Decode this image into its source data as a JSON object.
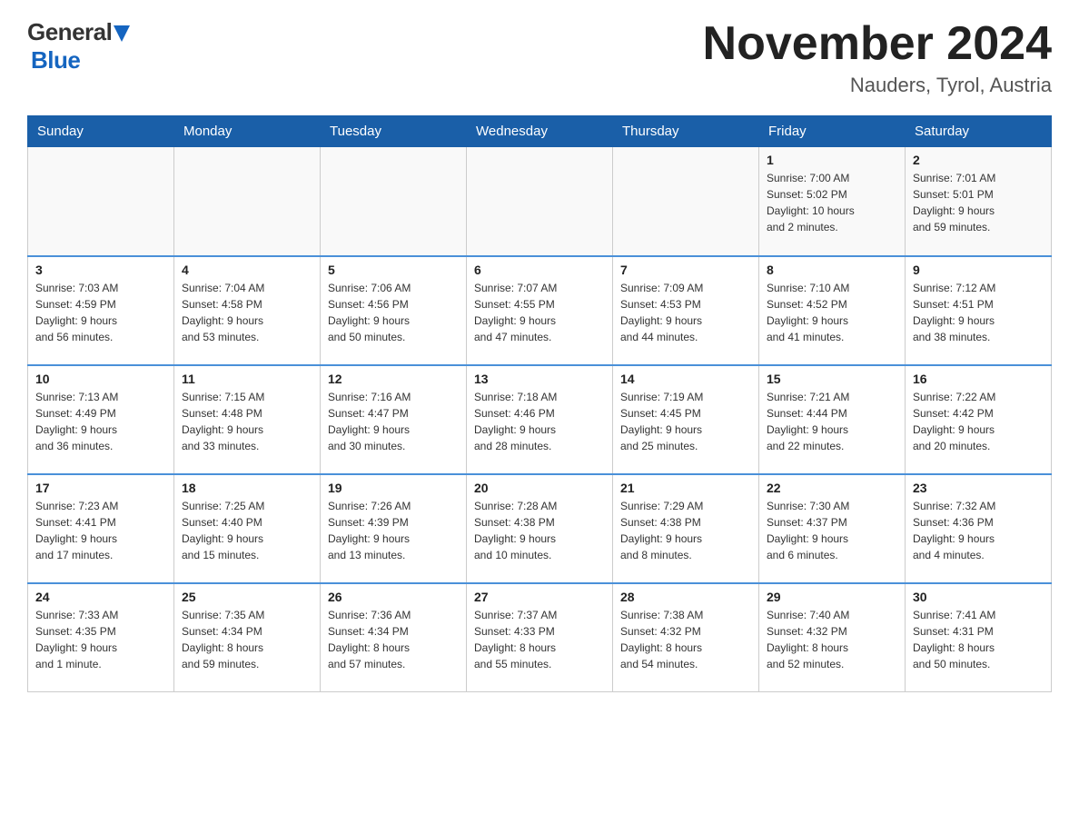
{
  "header": {
    "logo_general": "General",
    "logo_blue": "Blue",
    "month_title": "November 2024",
    "location": "Nauders, Tyrol, Austria"
  },
  "weekdays": [
    "Sunday",
    "Monday",
    "Tuesday",
    "Wednesday",
    "Thursday",
    "Friday",
    "Saturday"
  ],
  "weeks": [
    [
      {
        "day": "",
        "info": ""
      },
      {
        "day": "",
        "info": ""
      },
      {
        "day": "",
        "info": ""
      },
      {
        "day": "",
        "info": ""
      },
      {
        "day": "",
        "info": ""
      },
      {
        "day": "1",
        "info": "Sunrise: 7:00 AM\nSunset: 5:02 PM\nDaylight: 10 hours\nand 2 minutes."
      },
      {
        "day": "2",
        "info": "Sunrise: 7:01 AM\nSunset: 5:01 PM\nDaylight: 9 hours\nand 59 minutes."
      }
    ],
    [
      {
        "day": "3",
        "info": "Sunrise: 7:03 AM\nSunset: 4:59 PM\nDaylight: 9 hours\nand 56 minutes."
      },
      {
        "day": "4",
        "info": "Sunrise: 7:04 AM\nSunset: 4:58 PM\nDaylight: 9 hours\nand 53 minutes."
      },
      {
        "day": "5",
        "info": "Sunrise: 7:06 AM\nSunset: 4:56 PM\nDaylight: 9 hours\nand 50 minutes."
      },
      {
        "day": "6",
        "info": "Sunrise: 7:07 AM\nSunset: 4:55 PM\nDaylight: 9 hours\nand 47 minutes."
      },
      {
        "day": "7",
        "info": "Sunrise: 7:09 AM\nSunset: 4:53 PM\nDaylight: 9 hours\nand 44 minutes."
      },
      {
        "day": "8",
        "info": "Sunrise: 7:10 AM\nSunset: 4:52 PM\nDaylight: 9 hours\nand 41 minutes."
      },
      {
        "day": "9",
        "info": "Sunrise: 7:12 AM\nSunset: 4:51 PM\nDaylight: 9 hours\nand 38 minutes."
      }
    ],
    [
      {
        "day": "10",
        "info": "Sunrise: 7:13 AM\nSunset: 4:49 PM\nDaylight: 9 hours\nand 36 minutes."
      },
      {
        "day": "11",
        "info": "Sunrise: 7:15 AM\nSunset: 4:48 PM\nDaylight: 9 hours\nand 33 minutes."
      },
      {
        "day": "12",
        "info": "Sunrise: 7:16 AM\nSunset: 4:47 PM\nDaylight: 9 hours\nand 30 minutes."
      },
      {
        "day": "13",
        "info": "Sunrise: 7:18 AM\nSunset: 4:46 PM\nDaylight: 9 hours\nand 28 minutes."
      },
      {
        "day": "14",
        "info": "Sunrise: 7:19 AM\nSunset: 4:45 PM\nDaylight: 9 hours\nand 25 minutes."
      },
      {
        "day": "15",
        "info": "Sunrise: 7:21 AM\nSunset: 4:44 PM\nDaylight: 9 hours\nand 22 minutes."
      },
      {
        "day": "16",
        "info": "Sunrise: 7:22 AM\nSunset: 4:42 PM\nDaylight: 9 hours\nand 20 minutes."
      }
    ],
    [
      {
        "day": "17",
        "info": "Sunrise: 7:23 AM\nSunset: 4:41 PM\nDaylight: 9 hours\nand 17 minutes."
      },
      {
        "day": "18",
        "info": "Sunrise: 7:25 AM\nSunset: 4:40 PM\nDaylight: 9 hours\nand 15 minutes."
      },
      {
        "day": "19",
        "info": "Sunrise: 7:26 AM\nSunset: 4:39 PM\nDaylight: 9 hours\nand 13 minutes."
      },
      {
        "day": "20",
        "info": "Sunrise: 7:28 AM\nSunset: 4:38 PM\nDaylight: 9 hours\nand 10 minutes."
      },
      {
        "day": "21",
        "info": "Sunrise: 7:29 AM\nSunset: 4:38 PM\nDaylight: 9 hours\nand 8 minutes."
      },
      {
        "day": "22",
        "info": "Sunrise: 7:30 AM\nSunset: 4:37 PM\nDaylight: 9 hours\nand 6 minutes."
      },
      {
        "day": "23",
        "info": "Sunrise: 7:32 AM\nSunset: 4:36 PM\nDaylight: 9 hours\nand 4 minutes."
      }
    ],
    [
      {
        "day": "24",
        "info": "Sunrise: 7:33 AM\nSunset: 4:35 PM\nDaylight: 9 hours\nand 1 minute."
      },
      {
        "day": "25",
        "info": "Sunrise: 7:35 AM\nSunset: 4:34 PM\nDaylight: 8 hours\nand 59 minutes."
      },
      {
        "day": "26",
        "info": "Sunrise: 7:36 AM\nSunset: 4:34 PM\nDaylight: 8 hours\nand 57 minutes."
      },
      {
        "day": "27",
        "info": "Sunrise: 7:37 AM\nSunset: 4:33 PM\nDaylight: 8 hours\nand 55 minutes."
      },
      {
        "day": "28",
        "info": "Sunrise: 7:38 AM\nSunset: 4:32 PM\nDaylight: 8 hours\nand 54 minutes."
      },
      {
        "day": "29",
        "info": "Sunrise: 7:40 AM\nSunset: 4:32 PM\nDaylight: 8 hours\nand 52 minutes."
      },
      {
        "day": "30",
        "info": "Sunrise: 7:41 AM\nSunset: 4:31 PM\nDaylight: 8 hours\nand 50 minutes."
      }
    ]
  ]
}
